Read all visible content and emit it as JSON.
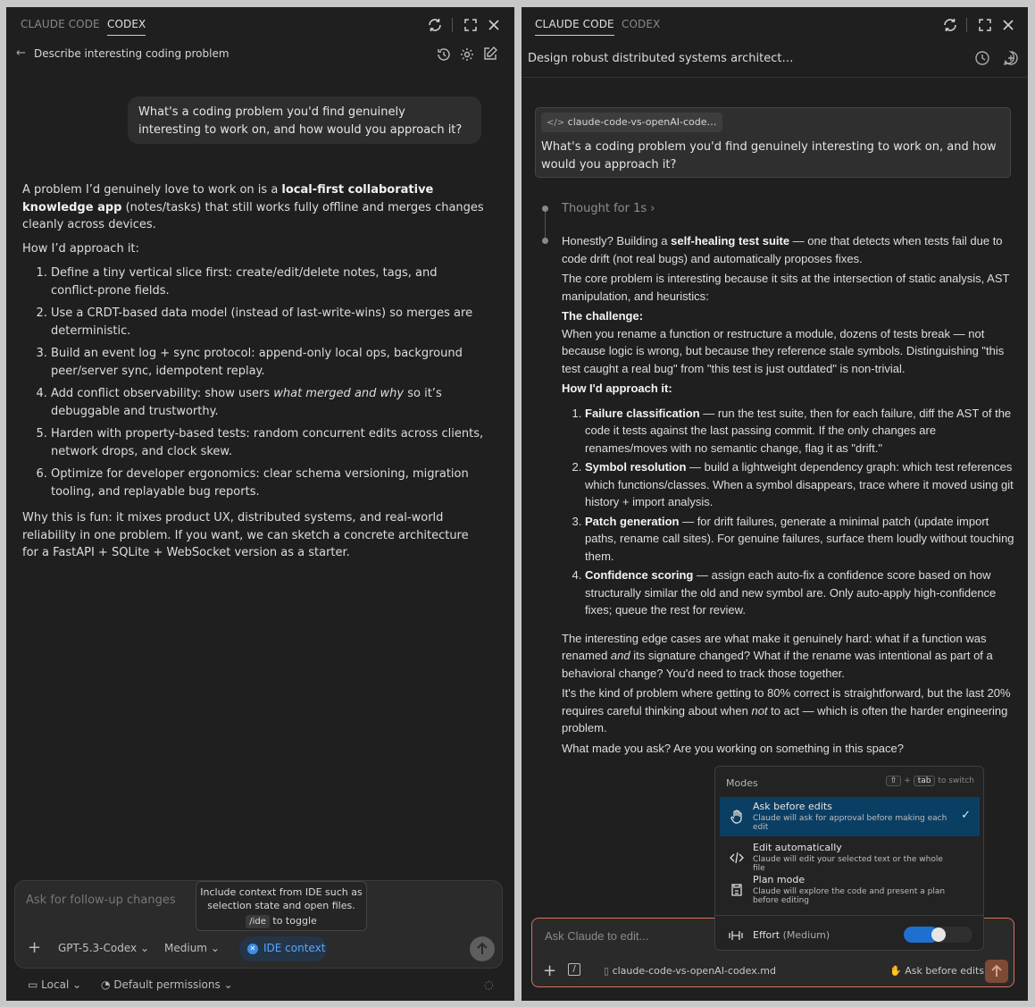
{
  "left": {
    "tabs": [
      "CLAUDE CODE",
      "CODEX"
    ],
    "active_tab": "CODEX",
    "title": "Describe interesting coding problem",
    "user_message": "What's a coding problem you'd find genuinely interesting to work on, and how would you approach it?",
    "response": {
      "intro_pre": "A problem I’d genuinely love to work on is a ",
      "intro_bold": "local-first collaborative knowledge app",
      "intro_post": " (notes/tasks) that still works fully offline and merges changes cleanly across devices.",
      "approach_heading": "How I’d approach it:",
      "steps": [
        "Define a tiny vertical slice first: create/edit/delete notes, tags, and conflict-prone fields.",
        "Use a CRDT-based data model (instead of last-write-wins) so merges are deterministic.",
        "Build an event log + sync protocol: append-only local ops, background peer/server sync, idempotent replay.",
        "Harden with property-based tests: random concurrent edits across clients, network drops, and clock skew.",
        "Optimize for developer ergonomics: clear schema versioning, migration tooling, and replayable bug reports."
      ],
      "step4_pre": "Add conflict observability: show users ",
      "step4_italic": "what merged and why",
      "step4_post": " so it’s debuggable and trustworthy.",
      "closing": "Why this is fun: it mixes product UX, distributed systems, and real-world reliability in one problem. If you want, we can sketch a concrete architecture for a FastAPI + SQLite + WebSocket version as a starter."
    },
    "composer": {
      "placeholder": "Ask for follow-up changes",
      "tooltip_line1": "Include context from IDE such as",
      "tooltip_line2": "selection state and open files.",
      "tooltip_key": "/ide",
      "tooltip_suffix": "to toggle",
      "model": "GPT-5.3-Codex",
      "effort": "Medium",
      "ide_context": "IDE context"
    },
    "footer": {
      "location": "Local",
      "permissions": "Default permissions"
    }
  },
  "right": {
    "tabs": [
      "CLAUDE CODE",
      "CODEX"
    ],
    "active_tab": "CLAUDE CODE",
    "title": "Design robust distributed systems architect…",
    "user_file_chip": "claude-code-vs-openAI-code…",
    "user_message": "What's a coding problem you'd find genuinely interesting to work on, and how would you approach it?",
    "thought": "Thought for 1s",
    "response": {
      "p1_pre": "Honestly? Building a ",
      "p1_bold": "self-healing test suite",
      "p1_post": " — one that detects when tests fail due to code drift (not real bugs) and automatically proposes fixes.",
      "p2": "The core problem is interesting because it sits at the intersection of static analysis, AST manipulation, and heuristics:",
      "challenge_heading": "The challenge:",
      "challenge_text": "When you rename a function or restructure a module, dozens of tests break — not because logic is wrong, but because they reference stale symbols. Distinguishing \"this test caught a real bug\" from \"this test is just outdated\" is non-trivial.",
      "approach_heading": "How I'd approach it:",
      "steps": [
        {
          "bold": "Failure classification",
          "text": " — run the test suite, then for each failure, diff the AST of the code it tests against the last passing commit. If the only changes are renames/moves with no semantic change, flag it as \"drift.\""
        },
        {
          "bold": "Symbol resolution",
          "text": " — build a lightweight dependency graph: which test references which functions/classes. When a symbol disappears, trace where it moved using git history + import analysis."
        },
        {
          "bold": "Patch generation",
          "text": " — for drift failures, generate a minimal patch (update import paths, rename call sites). For genuine failures, surface them loudly without touching them."
        },
        {
          "bold": "Confidence scoring",
          "text": " — assign each auto-fix a confidence score based on how structurally similar the old and new symbol are. Only auto-apply high-confidence fixes; queue the rest for review."
        }
      ],
      "edge_pre": "The interesting edge cases are what make it genuinely hard: what if a function was renamed ",
      "edge_italic": "and",
      "edge_post": " its signature changed? What if the rename was intentional as part of a behavioral change? You'd need to track those together.",
      "kind_pre": "It's the kind of problem where getting to 80% correct is straightforward, but the last 20% requires careful thinking about when ",
      "kind_italic": "not",
      "kind_post": " to act — which is often the harder engineering problem.",
      "question": "What made you ask? Are you working on something in this space?"
    },
    "modes": {
      "heading": "Modes",
      "hint_key1": "⇧",
      "hint_plus": "+",
      "hint_key2": "tab",
      "hint_suffix": "to switch",
      "items": [
        {
          "title": "Ask before edits",
          "desc": "Claude will ask for approval before making each edit",
          "selected": true
        },
        {
          "title": "Edit automatically",
          "desc": "Claude will edit your selected text or the whole file",
          "selected": false
        },
        {
          "title": "Plan mode",
          "desc": "Claude will explore the code and present a plan before editing",
          "selected": false
        }
      ],
      "effort_label": "Effort",
      "effort_value": "(Medium)",
      "effort_level": 0.5
    },
    "composer": {
      "placeholder": "Ask Claude to edit...",
      "file": "claude-code-vs-openAI-codex.md",
      "mode": "Ask before edits"
    },
    "colors": {
      "accent_blue": "#1f6fd1",
      "selected_mode": "#0b3e63",
      "composer_border": "#d8715a",
      "send_button": "#7e4a35"
    }
  }
}
